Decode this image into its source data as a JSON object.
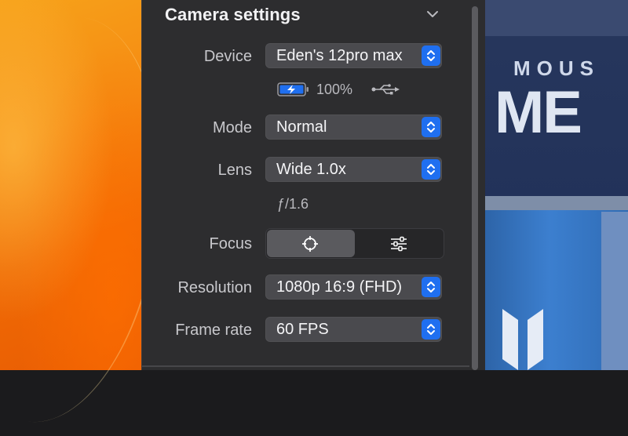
{
  "panel": {
    "title": "Camera settings",
    "collapse_icon": "chevron-down-icon"
  },
  "device": {
    "label": "Device",
    "value": "Eden's 12pro max",
    "battery_percent": "100%",
    "battery_icon": "battery-charging-icon",
    "connection_icon": "usb-icon"
  },
  "mode": {
    "label": "Mode",
    "value": "Normal"
  },
  "lens": {
    "label": "Lens",
    "value": "Wide 1.0x",
    "aperture": "ƒ/1.6"
  },
  "focus": {
    "label": "Focus",
    "options": [
      {
        "icon": "crosshair-icon",
        "selected": true
      },
      {
        "icon": "sliders-icon",
        "selected": false
      }
    ]
  },
  "resolution": {
    "label": "Resolution",
    "value": "1080p 16:9 (FHD)"
  },
  "frame_rate": {
    "label": "Frame rate",
    "value": "60 FPS"
  },
  "preview": {
    "text_line1": "MOUS",
    "text_line2": "ME"
  },
  "colors": {
    "accent": "#1f6ff0",
    "panel_bg": "#2d2d2f",
    "control_bg": "#4a4a4e"
  }
}
